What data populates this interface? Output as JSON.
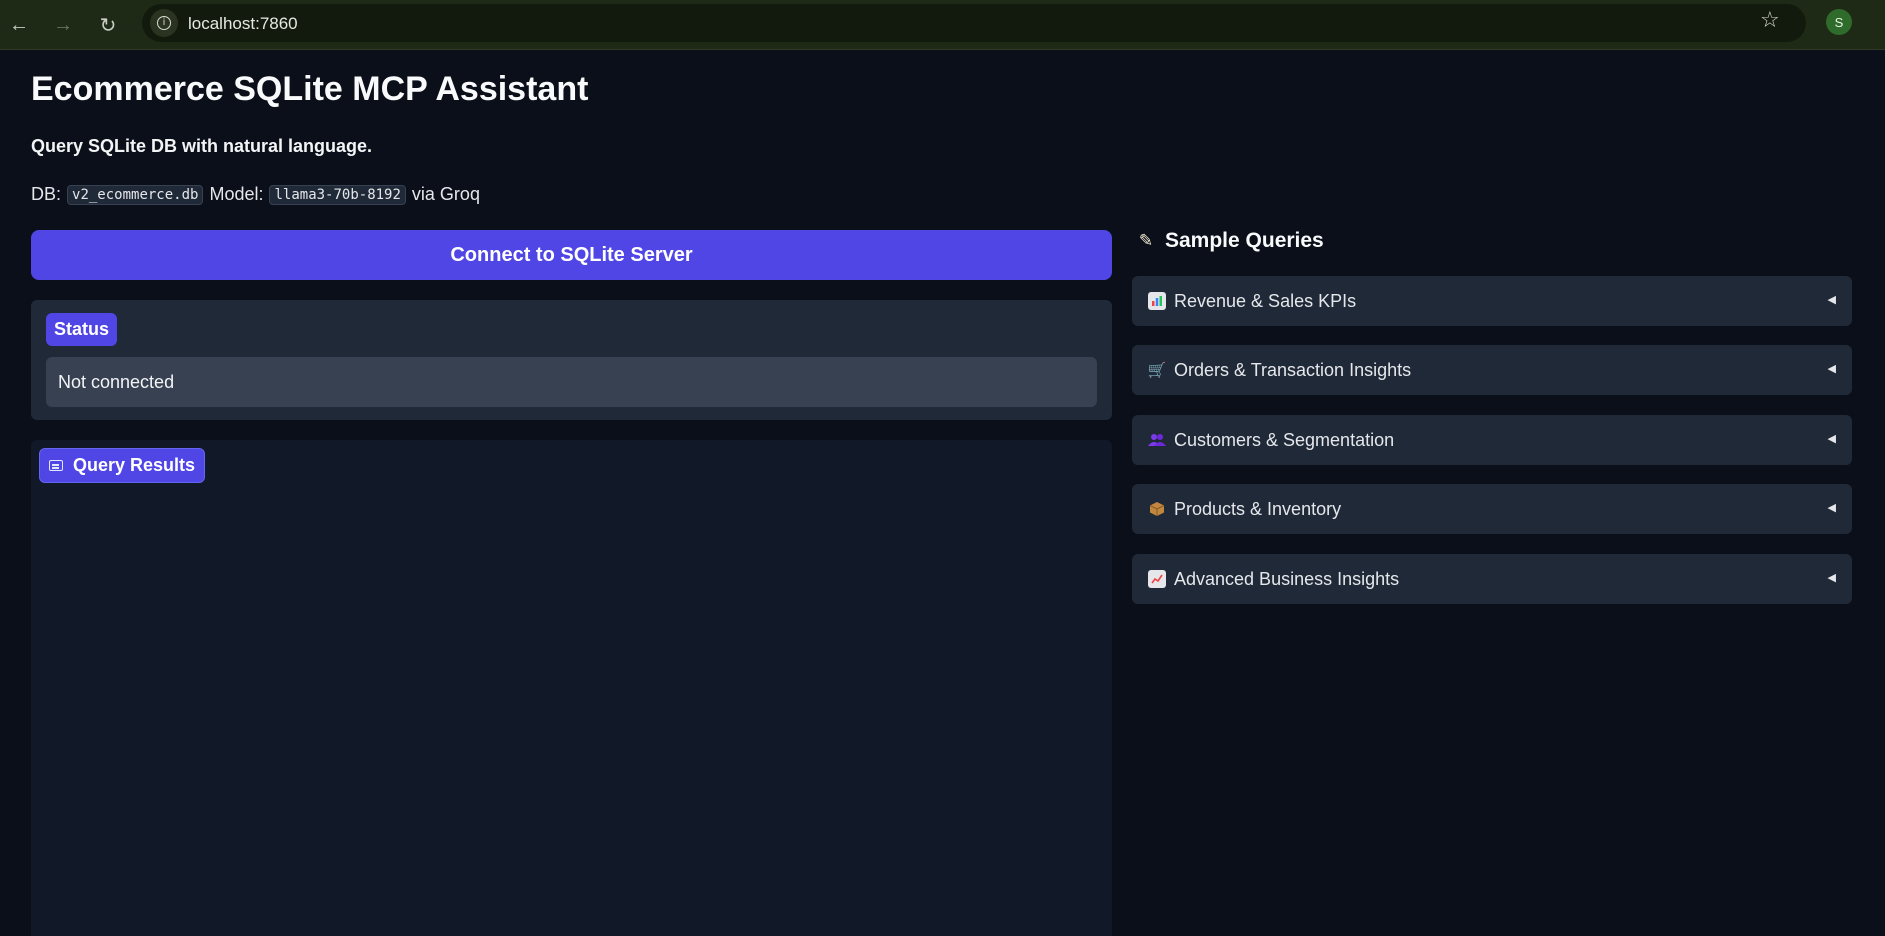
{
  "browser": {
    "url": "localhost:7860",
    "profile_initial": "S",
    "icons": {
      "back": "arrow-left-icon",
      "forward": "arrow-right-icon",
      "reload": "reload-icon",
      "site_info": "info-icon",
      "bookmark": "star-icon"
    }
  },
  "app": {
    "title": "Ecommerce SQLite MCP Assistant",
    "subtitle": "Query SQLite DB with natural language.",
    "info": {
      "db_label": "DB:",
      "db_value": "v2_ecommerce.db",
      "model_label": "Model:",
      "model_value": "llama3-70b-8192",
      "provider_text": "via Groq"
    },
    "connect_button": "Connect to SQLite Server",
    "status": {
      "label": "Status",
      "value": "Not connected"
    },
    "results": {
      "label": "Query Results",
      "icon": "chat-icon"
    },
    "sample_queries": {
      "title": "Sample Queries",
      "icon": "memo-icon",
      "items": [
        {
          "label": "Revenue & Sales KPIs",
          "icon": "bar-chart-icon"
        },
        {
          "label": "Orders & Transaction Insights",
          "icon": "shopping-cart-icon"
        },
        {
          "label": "Customers & Segmentation",
          "icon": "people-icon"
        },
        {
          "label": "Products & Inventory",
          "icon": "package-icon"
        },
        {
          "label": "Advanced Business Insights",
          "icon": "trending-up-icon"
        }
      ]
    }
  },
  "colors": {
    "background": "#0b0f19",
    "accent": "#4f46e5",
    "panel": "#1f2937",
    "field": "#374151"
  }
}
